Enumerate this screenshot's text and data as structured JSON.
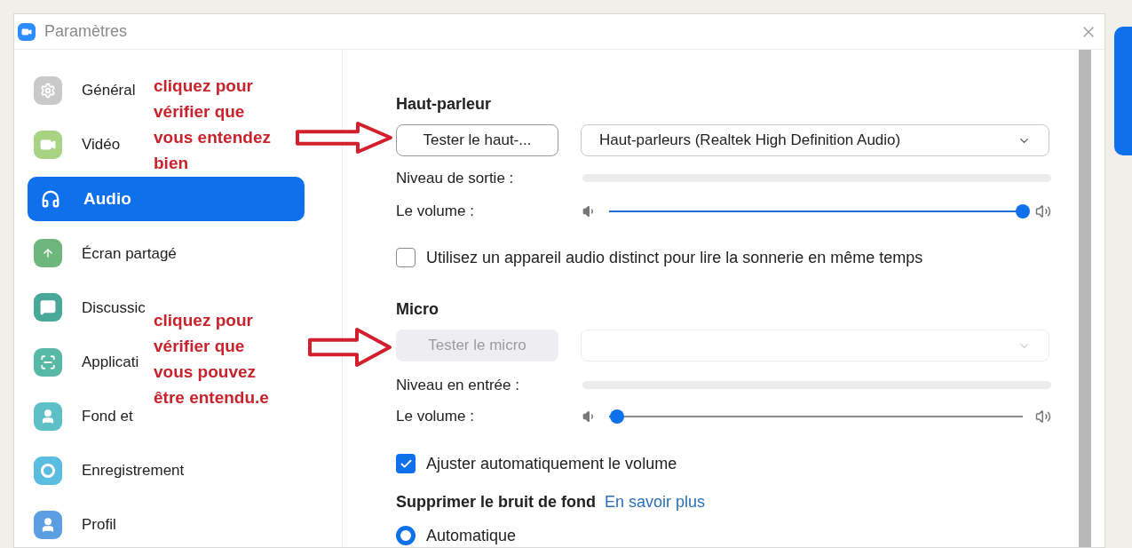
{
  "window": {
    "title": "Paramètres"
  },
  "sidebar": {
    "items": [
      {
        "label": "Général",
        "kind": "gear",
        "color": "#c9c9c9",
        "selected": false
      },
      {
        "label": "Vidéo",
        "kind": "video",
        "color": "#a7d383",
        "selected": false
      },
      {
        "label": "Audio",
        "kind": "headphones",
        "color": "#0e71eb",
        "selected": true
      },
      {
        "label": "Écran partagé",
        "kind": "share",
        "color": "#6db77d",
        "selected": false
      },
      {
        "label": "Discussic",
        "kind": "chat",
        "color": "#4aa898",
        "selected": false
      },
      {
        "label": "Applicati",
        "kind": "apps",
        "color": "#58b8a6",
        "selected": false
      },
      {
        "label": "Fond et",
        "kind": "background",
        "color": "#5cc0c6",
        "selected": false
      },
      {
        "label": "Enregistrement",
        "kind": "record",
        "color": "#5bbce2",
        "selected": false
      },
      {
        "label": "Profil",
        "kind": "profile",
        "color": "#5b9fe2",
        "selected": false
      }
    ]
  },
  "speaker": {
    "heading": "Haut-parleur",
    "test_button": {
      "label": "Tester le haut-...",
      "disabled": false
    },
    "device": {
      "value": "Haut-parleurs (Realtek High Definition Audio)",
      "disabled": false
    },
    "output": {
      "label": "Niveau de sortie :",
      "level": 0
    },
    "volume": {
      "label": "Le volume :",
      "level": 1
    },
    "separate_device": {
      "label": "Utilisez un appareil audio distinct pour lire la sonnerie en même temps",
      "checked": false
    }
  },
  "microphone": {
    "heading": "Micro",
    "test_button": {
      "label": "Tester le micro",
      "disabled": true
    },
    "device": {
      "disabled": true
    },
    "input": {
      "label": "Niveau en entrée :",
      "level": 0
    },
    "volume": {
      "label": "Le volume :",
      "level": 0.02
    },
    "auto_adjust": {
      "label": "Ajuster automatiquement le volume",
      "checked": true
    }
  },
  "noise_suppression": {
    "heading": "Supprimer le bruit de fond",
    "link": "En savoir plus",
    "options": [
      {
        "label": "Automatique",
        "selected": true
      }
    ]
  },
  "annotations": [
    {
      "lines": [
        "cliquez pour",
        "vérifier que",
        "vous entendez",
        "bien"
      ]
    },
    {
      "lines": [
        "cliquez pour",
        "vérifier que",
        "vous pouvez",
        "être entendu.e"
      ]
    }
  ]
}
